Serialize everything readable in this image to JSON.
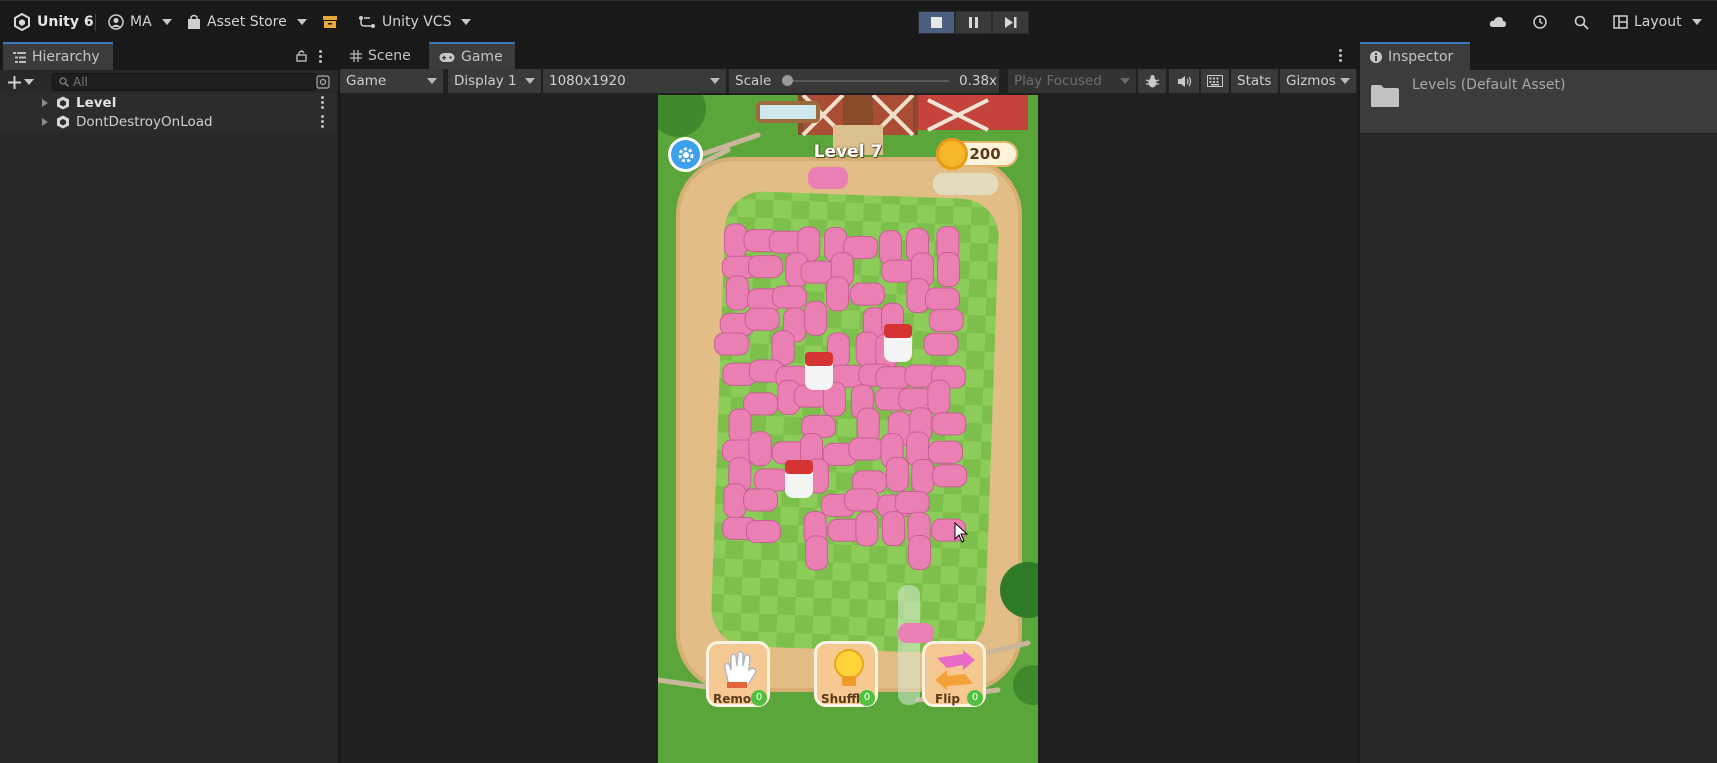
{
  "toolbar": {
    "unity_label": "Unity 6",
    "account_label": "MA",
    "asset_store_label": "Asset Store",
    "vcs_label": "Unity VCS",
    "layout_label": "Layout"
  },
  "hierarchy": {
    "tab_label": "Hierarchy",
    "search_placeholder": "All",
    "items": [
      {
        "label": "Level"
      },
      {
        "label": "DontDestroyOnLoad"
      }
    ]
  },
  "center_tabs": {
    "scene_label": "Scene",
    "game_label": "Game"
  },
  "game_bar": {
    "view_mode": "Game",
    "display": "Display 1",
    "resolution": "1080x1920",
    "scale_label": "Scale",
    "scale_value": "0.38x",
    "scale_fraction": 0.0,
    "play_mode": "Play Focused",
    "stats_label": "Stats",
    "gizmos_label": "Gizmos"
  },
  "inspector": {
    "tab_label": "Inspector",
    "asset_label": "Levels (Default Asset)"
  },
  "game": {
    "level_label": "Level 7",
    "coins": "200",
    "boosters": [
      {
        "label": "Remo",
        "count": "0"
      },
      {
        "label": "Shuffl",
        "count": "0"
      },
      {
        "label": "Flip",
        "count": "0"
      }
    ]
  },
  "colors": {
    "accent": "#3a79bb",
    "pig": "#e97fb3",
    "grass": "#5da83b",
    "track": "#d9b382"
  }
}
